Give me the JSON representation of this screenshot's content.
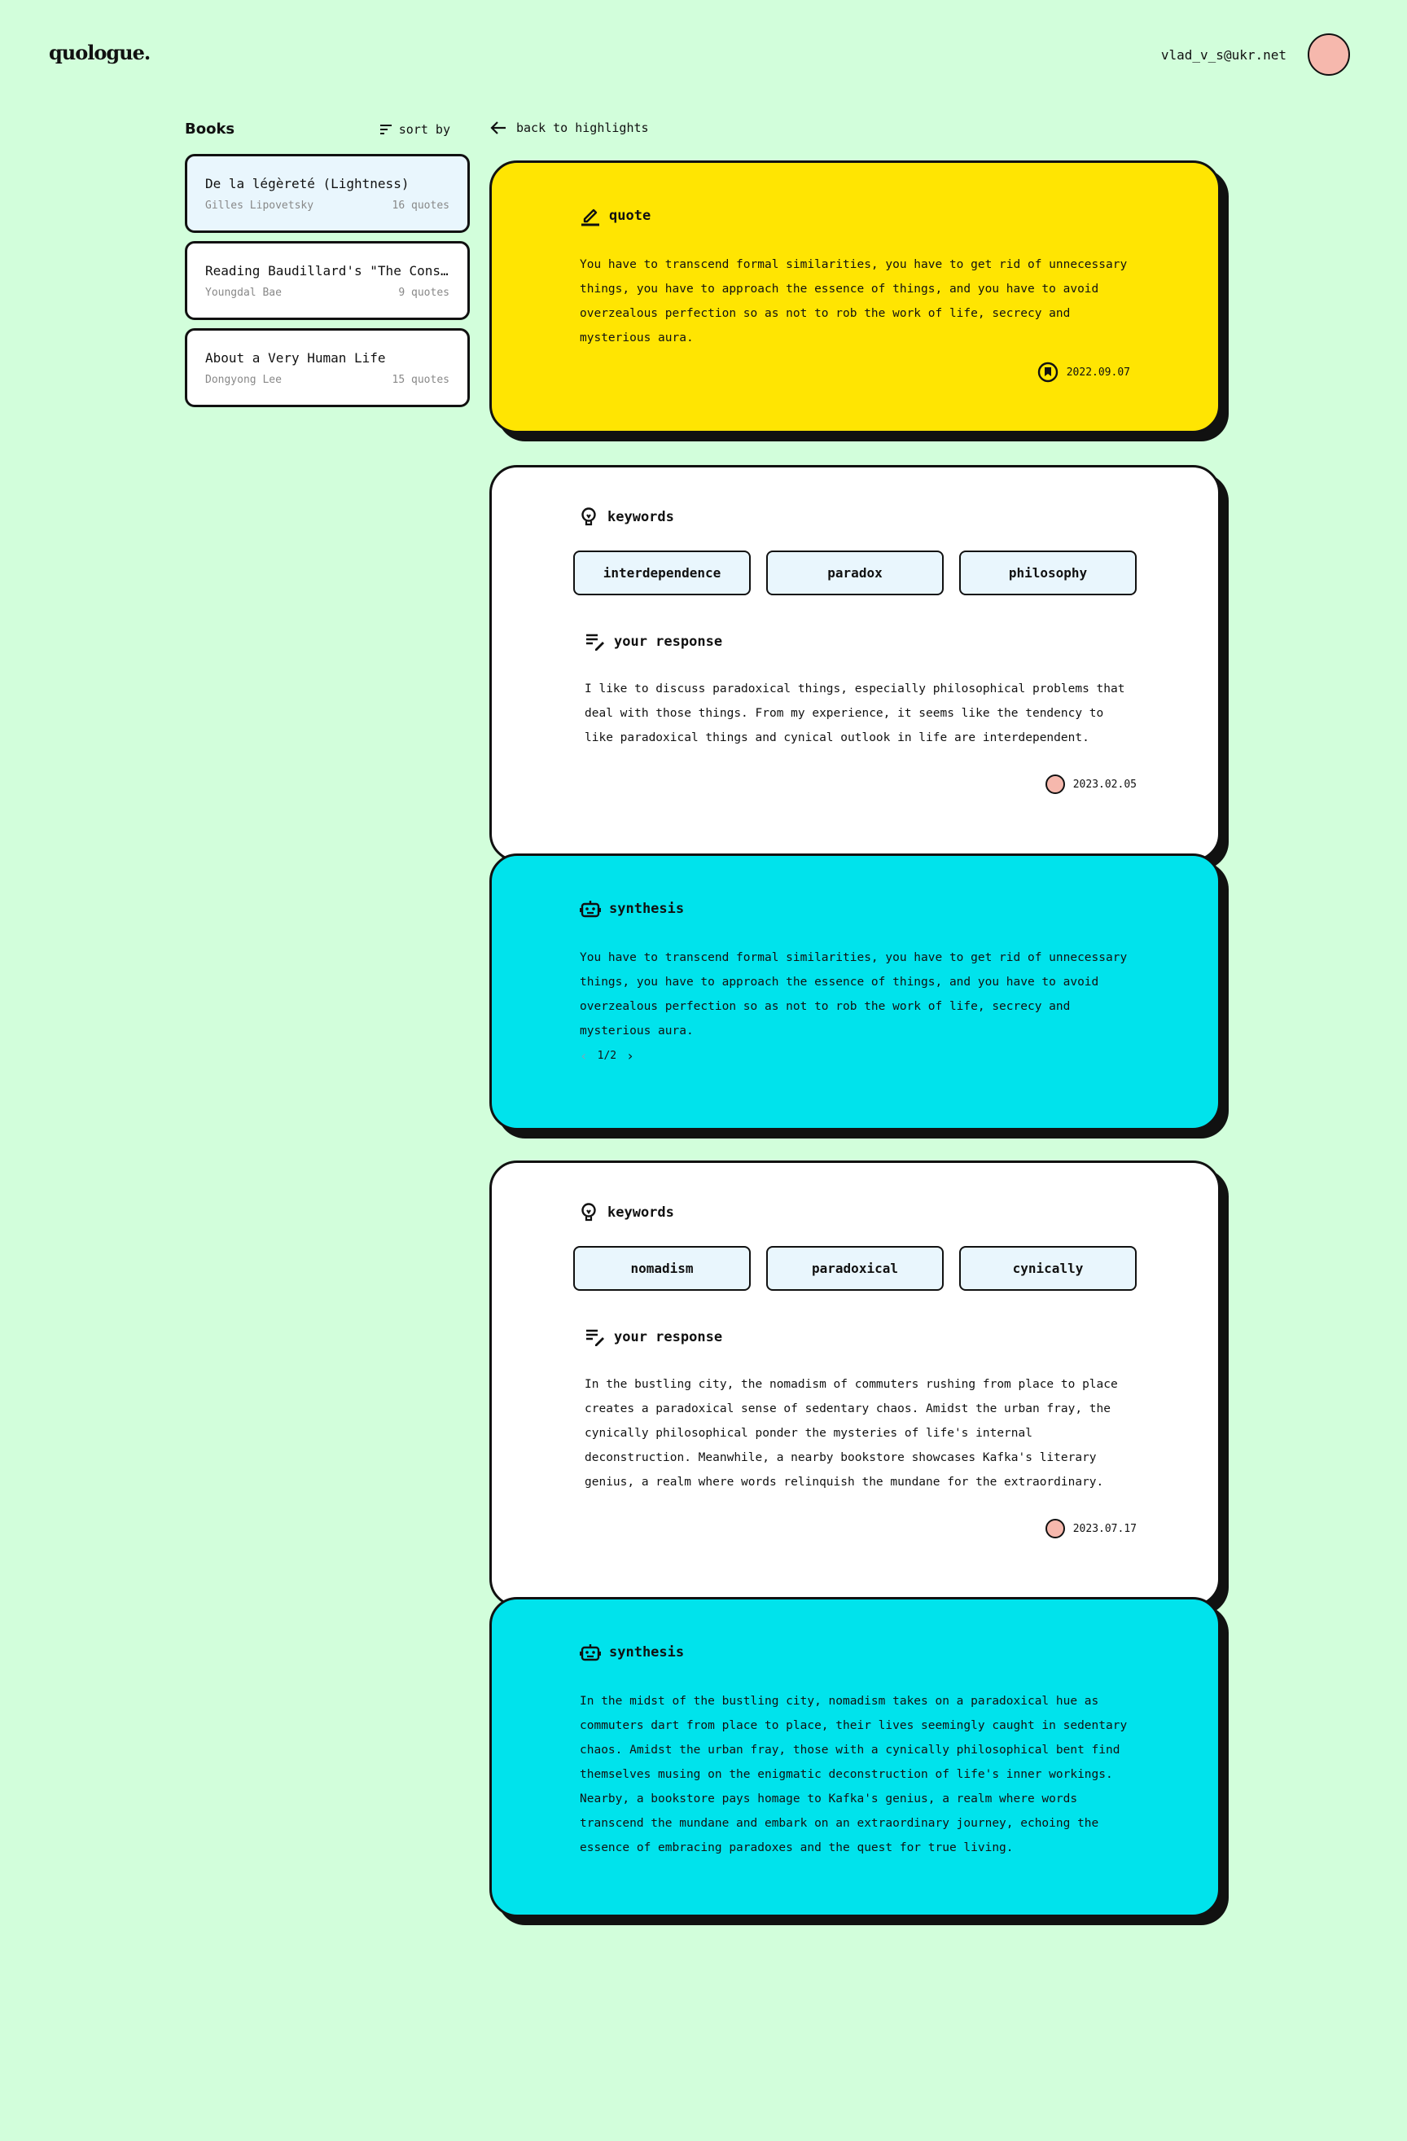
{
  "header": {
    "logo": "quologue.",
    "user_email": "vlad_v_s@ukr.net"
  },
  "sidebar": {
    "title": "Books",
    "sort_label": "sort by",
    "books": [
      {
        "title": "De la légèreté (Lightness)",
        "author": "Gilles Lipovetsky",
        "count": "16 quotes"
      },
      {
        "title": "Reading Baudillard's \"The Consumer Society\"",
        "author": "Youngdal Bae",
        "count": "9 quotes"
      },
      {
        "title": "About a Very Human Life",
        "author": "Dongyong Lee",
        "count": "15 quotes"
      }
    ]
  },
  "back_label": "back to highlights",
  "quote_card": {
    "heading": "quote",
    "text": "You have to transcend formal similarities, you have to get rid of unnecessary things, you have to approach the essence of things, and you have to avoid overzealous perfection so as not to rob the work of life, secrecy and mysterious aura.",
    "date": "2022.09.07"
  },
  "entries": [
    {
      "keywords_heading": "keywords",
      "keywords": [
        "interdependence",
        "paradox",
        "philosophy"
      ],
      "response_heading": "your response",
      "response": "I like to discuss paradoxical things, especially philosophical problems that deal with those things. From my experience, it seems like the tendency to like paradoxical things and cynical outlook in life are interdependent.",
      "date": "2023.02.05",
      "synthesis_heading": "synthesis",
      "synthesis": "You have to transcend formal similarities, you have to get rid of unnecessary things, you have to approach the essence of things, and you have to avoid overzealous perfection so as not to rob the work of life, secrecy and mysterious aura.",
      "pager": "1/2"
    },
    {
      "keywords_heading": "keywords",
      "keywords": [
        "nomadism",
        "paradoxical",
        "cynically"
      ],
      "response_heading": "your response",
      "response": "In the bustling city, the nomadism of commuters rushing from place to place creates a paradoxical sense of sedentary chaos. Amidst the urban fray, the cynically philosophical ponder the mysteries of life's internal deconstruction. Meanwhile, a nearby bookstore showcases Kafka's literary genius, a realm where words relinquish the mundane for the extraordinary.",
      "date": "2023.07.17",
      "synthesis_heading": "synthesis",
      "synthesis": "In the midst of the bustling city, nomadism takes on a paradoxical hue as commuters dart from place to place, their lives seemingly caught in sedentary chaos. Amidst the urban fray, those with a cynically philosophical bent find themselves musing on the enigmatic deconstruction of life's inner workings. Nearby, a bookstore pays homage to Kafka's genius, a realm where words transcend the mundane and embark on an extraordinary journey, echoing the essence of embracing paradoxes and the quest for true living."
    }
  ]
}
